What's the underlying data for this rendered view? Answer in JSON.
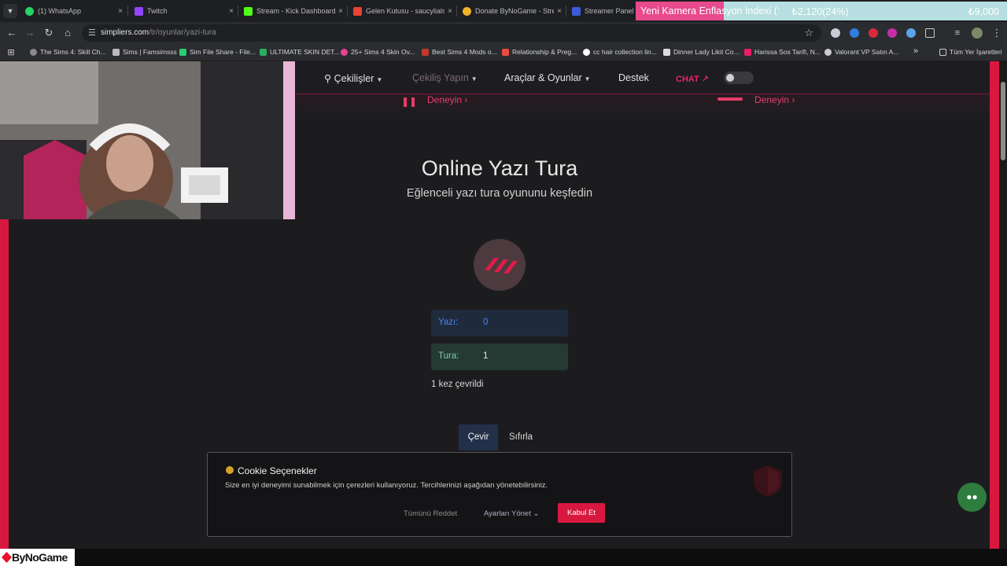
{
  "browser": {
    "tabs": [
      {
        "label": "(1) WhatsApp",
        "icon": "whatsapp-icon",
        "color": "#25d366"
      },
      {
        "label": "Twitch",
        "icon": "twitch-icon",
        "color": "#9146ff"
      },
      {
        "label": "Stream - Kick Dashboard",
        "icon": "kick-icon",
        "color": "#53fc18"
      },
      {
        "label": "Gelen Kutusu - saucylialsa",
        "icon": "gmail-icon",
        "color": "#ea4335"
      },
      {
        "label": "Donate ByNoGame - Stre",
        "icon": "bynogame-icon",
        "color": "#f0b429"
      },
      {
        "label": "Streamer Panel",
        "icon": "panel-icon",
        "color": "#3b5bdb"
      }
    ],
    "tab_close_glyph": "×",
    "ticker": {
      "label": "Yeni Kamera Enflasyon Indexi (:",
      "value": "₺2,120(24%)",
      "goal": "₺9,000"
    },
    "url": {
      "host": "simpliers.com",
      "path": "/tr/oyunlar/yazi-tura"
    },
    "bookmarks": [
      {
        "label": "The Sims 4: Skill Ch...",
        "color": "#8a8a8a"
      },
      {
        "label": "Sims | Famsimsss",
        "color": "#bbbbbb"
      },
      {
        "label": "Sim File Share - File...",
        "color": "#2ecc71"
      },
      {
        "label": "ULTIMATE SKIN DET...",
        "color": "#27ae60"
      },
      {
        "label": "25+ Sims 4 Skin Ov...",
        "color": "#e84393"
      },
      {
        "label": "Best Sims 4 Mods o...",
        "color": "#c0392b"
      },
      {
        "label": "Relationship & Preg...",
        "color": "#e74c3c"
      },
      {
        "label": "cc hair collection lin...",
        "color": "#ffffff"
      },
      {
        "label": "Dinner Lady Likit Co...",
        "color": "#dddddd"
      },
      {
        "label": "Harissa Sos Tarifi, N...",
        "color": "#e91e63"
      },
      {
        "label": "Valorant VP Satın A...",
        "color": "#cccccc"
      }
    ],
    "bookmarks_more": "»",
    "all_bookmarks": "Tüm Yer İşaretleri"
  },
  "site": {
    "nav": {
      "giveaways": "Çekilişler",
      "make_giveaway": "Çekiliş Yapın",
      "tools": "Araçlar & Oyunlar",
      "support": "Destek",
      "chat": "CHAT"
    },
    "try_label": "Deneyin",
    "title": "Online Yazı Tura",
    "subtitle": "Eğlenceli yazı tura oyununu keşfedin",
    "score": {
      "heads_label": "Yazı:",
      "heads_value": "0",
      "tails_label": "Tura:",
      "tails_value": "1"
    },
    "spin_count": "1 kez çevrildi",
    "buttons": {
      "flip": "Çevir",
      "reset": "Sıfırla"
    },
    "cookie": {
      "title": "Cookie Seçenekler",
      "desc": "Size en iyi deneyimi sunabilmek için çerezleri kullanıyoruz. Tercihlerinizi aşağıdan yönetebilirsiniz.",
      "reject": "Tümünü Reddet",
      "manage": "Ayarları Yönet",
      "accept": "Kabul Et"
    }
  },
  "overlay": {
    "brand": "ByNoGame"
  },
  "colors": {
    "accent": "#d9183f",
    "heads_box": "#1f2a3d",
    "tails_box": "#243a33",
    "heads_text": "#4a86e8",
    "tails_text": "#7fd1a8"
  }
}
